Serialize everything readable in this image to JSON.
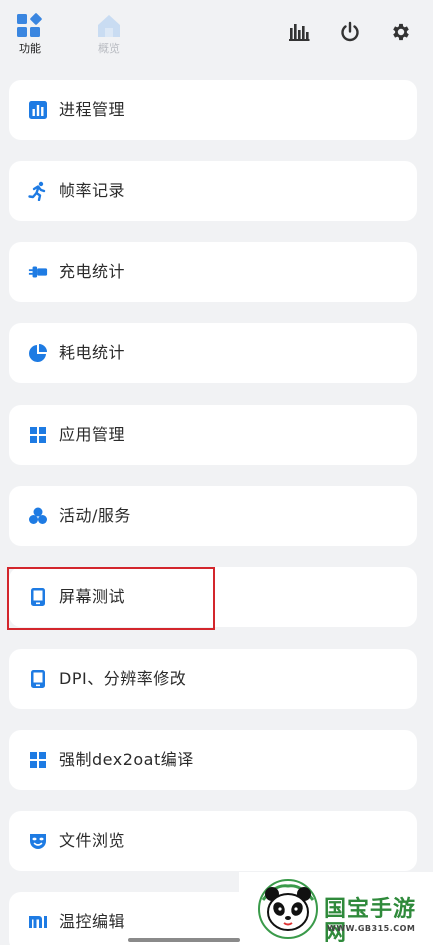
{
  "tabs": [
    {
      "label": "功能",
      "icon": "grid-diamond-icon",
      "active": true
    },
    {
      "label": "概览",
      "icon": "home-icon",
      "active": false
    }
  ],
  "actions": [
    {
      "icon": "bar-chart-icon"
    },
    {
      "icon": "power-icon"
    },
    {
      "icon": "gear-icon"
    }
  ],
  "menu": [
    {
      "label": "进程管理",
      "icon": "bar-chart-icon"
    },
    {
      "label": "帧率记录",
      "icon": "running-icon"
    },
    {
      "label": "充电统计",
      "icon": "charger-icon"
    },
    {
      "label": "耗电统计",
      "icon": "pie-chart-icon"
    },
    {
      "label": "应用管理",
      "icon": "grid-icon"
    },
    {
      "label": "活动/服务",
      "icon": "bubbles-icon"
    },
    {
      "label": "屏幕测试",
      "icon": "tablet-icon"
    },
    {
      "label": "DPI、分辨率修改",
      "icon": "tablet-icon"
    },
    {
      "label": "强制dex2oat编译",
      "icon": "grid-icon"
    },
    {
      "label": "文件浏览",
      "icon": "mask-icon"
    },
    {
      "label": "温控编辑",
      "icon": "mi-icon"
    }
  ],
  "watermark": {
    "text": "国宝手游网",
    "url": "WWW.GB315.COM"
  },
  "colors": {
    "accent": "#1e7be3",
    "highlight": "#d3262c",
    "background": "#f1f2f4"
  }
}
